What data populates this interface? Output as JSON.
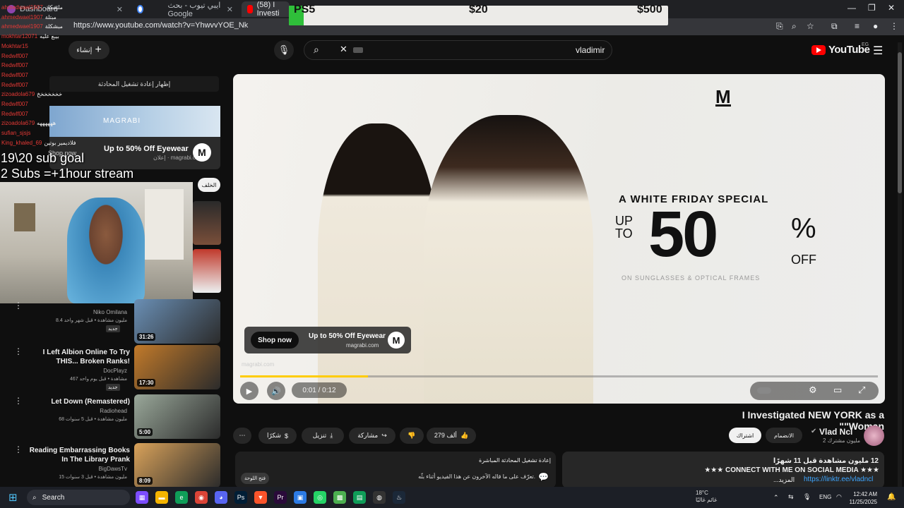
{
  "browser": {
    "tabs": [
      {
        "label": "Dashboard",
        "overlay": "ahmedwael1907 : ملشكك"
      },
      {
        "label": "ايبي تيوب - بحث Google"
      },
      {
        "label": "(58) I Investi"
      }
    ],
    "url": "https://www.youtube.com/watch?v=YhwvvYOE_Nk"
  },
  "goal_bar": {
    "label": "PS5",
    "mid": "$20",
    "end": "$500",
    "progress_fraction": 0.04,
    "fill_color": "#2fbf3a"
  },
  "header": {
    "logo": "YouTube",
    "region": "EG",
    "search_value": "vladimir",
    "create_label": "إنشاء"
  },
  "chat_overlay": {
    "lines": [
      {
        "user": "ahmedwael1907",
        "text": "ملشكك"
      },
      {
        "user": "ahmedwael1907",
        "text": "مبتلة"
      },
      {
        "user": "ahmedwael1907",
        "text": "مبشكلة"
      },
      {
        "user": "mokhtar12071",
        "text": "بيبع عليه"
      },
      {
        "user": "Mokhtar15",
        "text": ""
      },
      {
        "user": "Redwlf007",
        "text": ""
      },
      {
        "user": "Redwlf007",
        "text": ""
      },
      {
        "user": "Redwlf007",
        "text": ""
      },
      {
        "user": "Redwlf007",
        "text": ""
      },
      {
        "user": "zizoadola679",
        "text": "خخخخخخخ"
      },
      {
        "user": "Redwlf007",
        "text": ""
      },
      {
        "user": "Redwlf007",
        "text": ""
      },
      {
        "user": "zizoadola679",
        "text": "ههههههه"
      },
      {
        "user": "sufian_sjsjs",
        "text": ""
      },
      {
        "user": "King_khaled_69",
        "text": "فلاديمير بوتين"
      }
    ],
    "show_chat_label": "إظهار إعادة تشغيل المحادثة",
    "goal_line1": "19\\20 sub goal",
    "goal_line2": "2 Subs =+1hour stream",
    "back_label": "الخلف"
  },
  "ad_banner": {
    "brand": "MAGRABI",
    "title": "Up to 50% Off Eyewear",
    "domain": "magrabi.com",
    "sponsored": "إعلان",
    "shop_label": "Shop now",
    "logo_letter": "M"
  },
  "player": {
    "promo_title": "A WHITE FRIDAY SPECIAL",
    "promo_upto": "UP TO",
    "promo_value": "50",
    "promo_pct": "%",
    "promo_off": "OFF",
    "promo_sub": "ON SUNGLASSES & OPTICAL FRAMES",
    "logo_letter": "M",
    "ad_card_title": "Up to 50% Off Eyewear",
    "ad_card_domain": "magrabi.com",
    "shop_label": "Shop now",
    "ad_domain": "magrabi.com",
    "time": "0:01 / 0:12",
    "progress_fraction": 0.2
  },
  "video": {
    "title": "I Investigated NEW YORK as a \"Woman\"",
    "channel": "Vlad Ncl",
    "subs": "2 مليون مشترك",
    "subscribe_label": "اشتراك",
    "join_label": "الانضمام",
    "likes": "279 ألف",
    "share_label": "مشاركة",
    "download_label": "تنزيل",
    "thanks_label": "شكرًا",
    "desc_views": "12 مليون مشاهدة قبل 11 شهرًا",
    "desc_line": "★★★ CONNECT WITH ME ON SOCIAL MEDIA ★★★",
    "desc_link": "https://linktr.ee/vladncl",
    "desc_more": "...المزيد",
    "chat_replay_title": "إعادة تشغيل المحادثة المباشرة",
    "chat_replay_desc": "تعرّف على ما قاله الآخرون عن هذا الفيديو أثناء بثّه.",
    "chat_open_label": "فتح اللوحة"
  },
  "related": [
    {
      "title": "",
      "channel": "Niko Omilana",
      "meta": "8.4 مليون مشاهدة • قبل شهر واحد",
      "badge": "جديد",
      "duration": "31:26",
      "thumb_color": "#6a8fb5"
    },
    {
      "title": "I Left Albion Online To Try THIS... Broken Ranks!",
      "channel": "DocPlayz",
      "meta": "467 مشاهدة • قبل يوم واحد",
      "badge": "جديد",
      "duration": "17:30",
      "thumb_color": "#c27a2a"
    },
    {
      "title": "Let Down (Remastered)",
      "channel": "Radiohead",
      "meta": "68 مليون مشاهدة • قبل 5 سنوات",
      "badge": "",
      "duration": "5:00",
      "thumb_color": "#9aa89a"
    },
    {
      "title": "Reading Embarrassing Books In The Library Prank",
      "channel": "BigDawsTv",
      "meta": "15 مليون مشاهدة • قبل 3 سنوات",
      "badge": "",
      "duration": "8:09",
      "thumb_color": "#d9a25a"
    }
  ],
  "taskbar": {
    "search_label": "Search",
    "weather_temp": "18°C",
    "weather_desc": "غائم غالبًا",
    "lang": "ENG",
    "time": "12:42 AM",
    "date": "11/25/2025"
  }
}
